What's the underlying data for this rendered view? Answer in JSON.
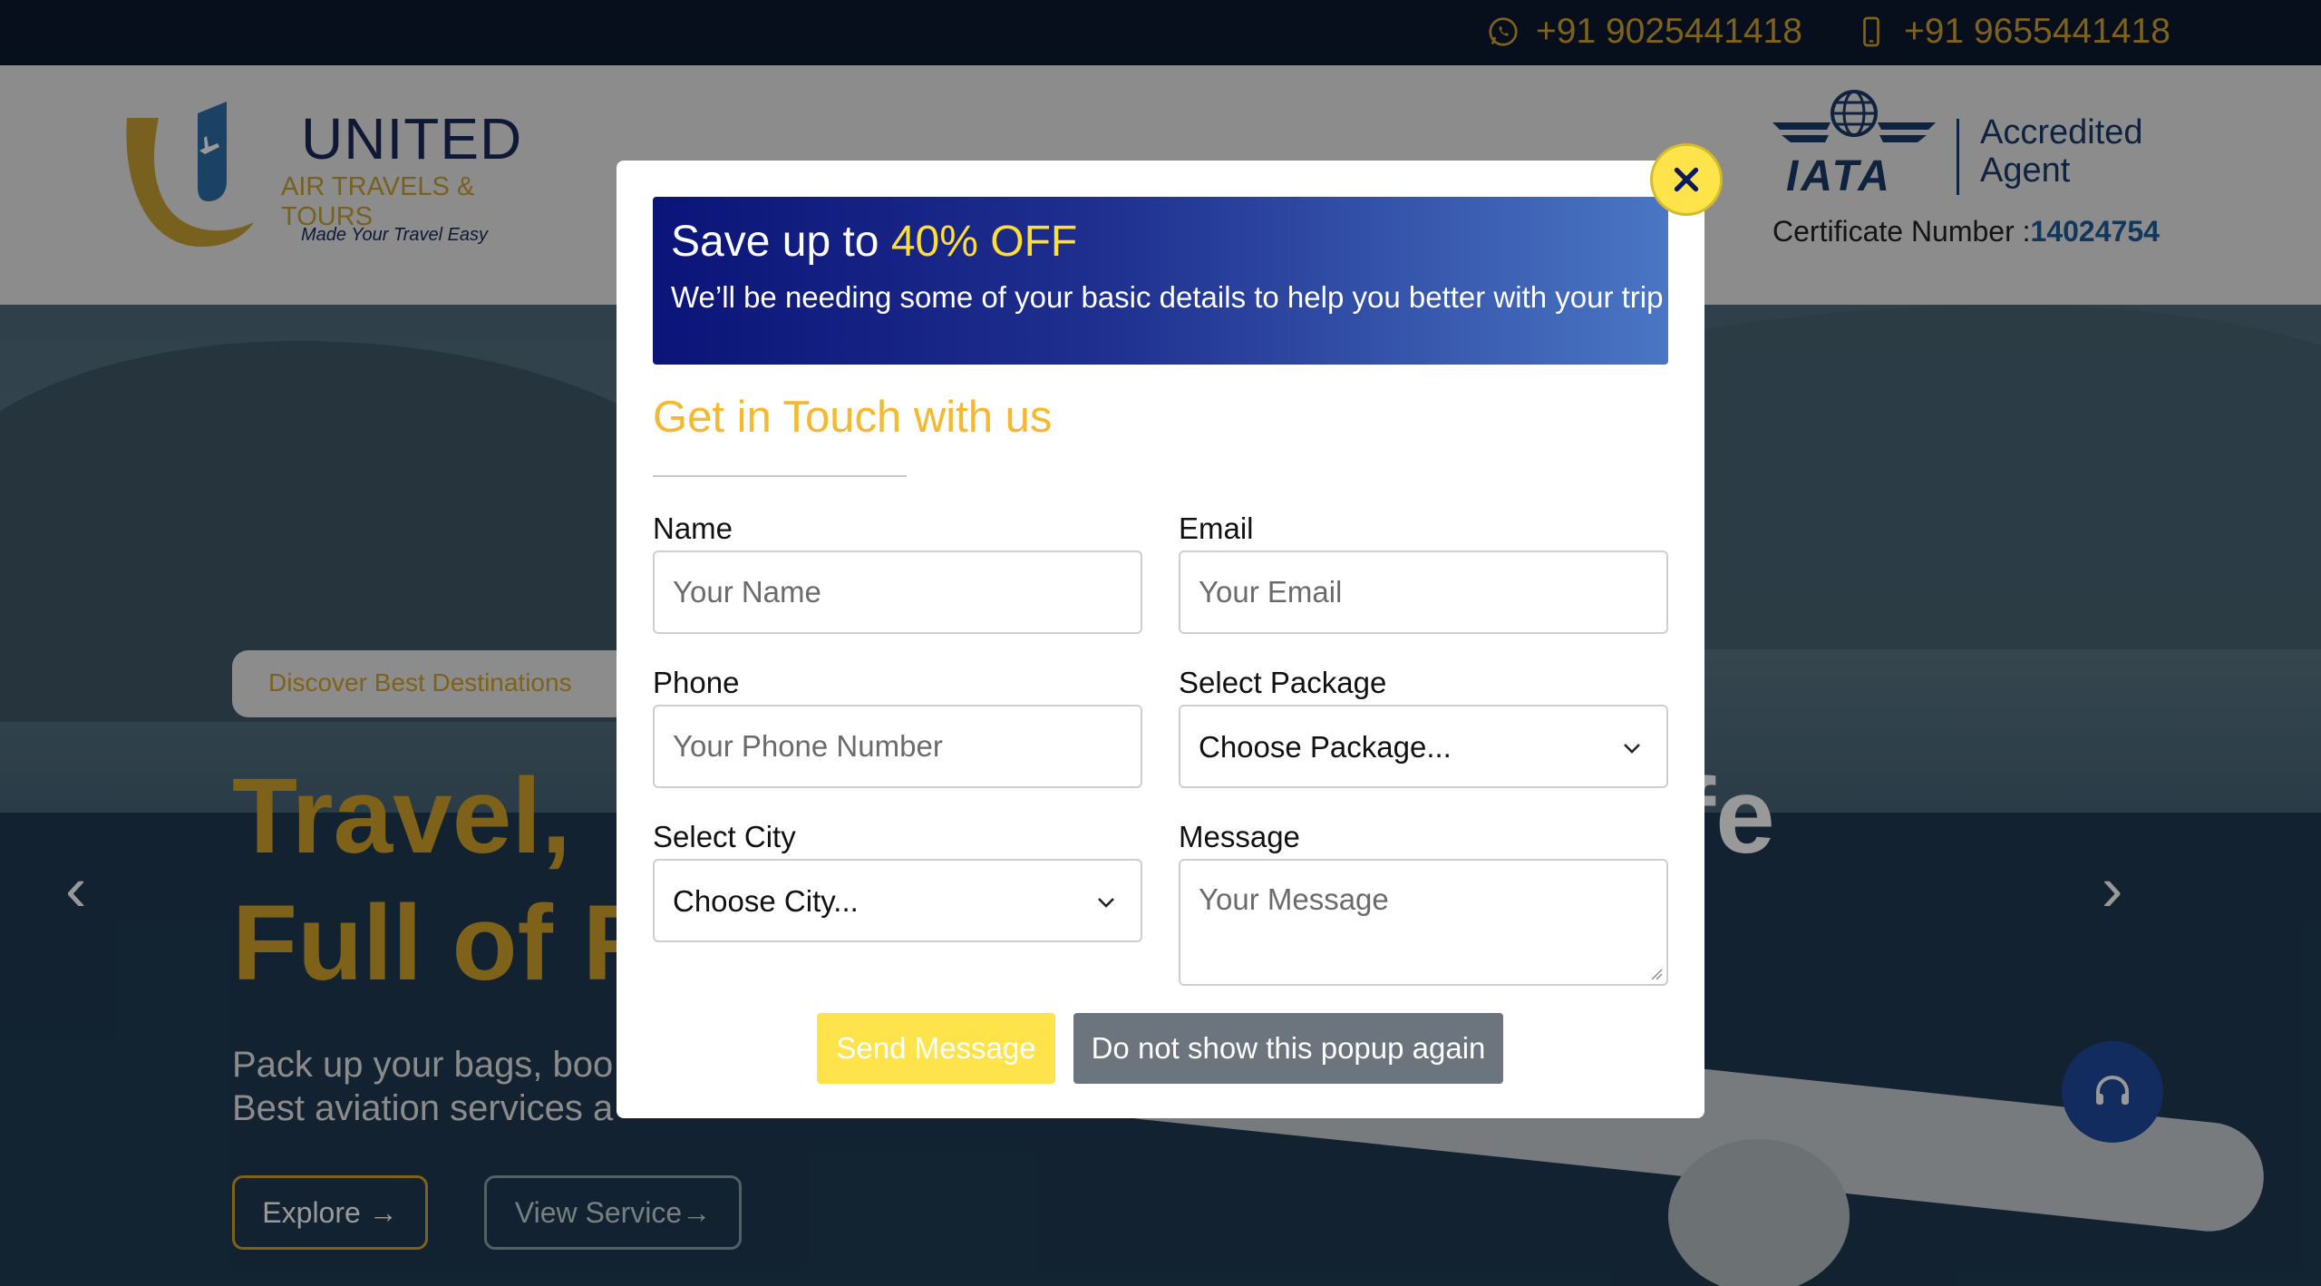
{
  "topbar": {
    "whatsapp_number": "+91 9025441418",
    "mobile_number": "+91 9655441418",
    "whatsapp_icon": "whatsapp-icon",
    "mobile_icon": "mobile-phone-icon"
  },
  "logo": {
    "title": "UNITED",
    "subtitle": "AIR TRAVELS & TOURS",
    "tagline": "Made Your Travel Easy"
  },
  "iata": {
    "word": "IATA",
    "accredited_line1": "Accredited",
    "accredited_line2": "Agent",
    "cert_label": "Certificate Number :",
    "cert_number": "14024754"
  },
  "hero": {
    "badge": "Discover Best Destinations",
    "title_line1": "Travel, ",
    "title_line2": "Full of F",
    "title_right": "ife",
    "subtitle_line1": "Pack up your bags, boo",
    "subtitle_line2": "Best aviation services a",
    "explore_label": "Explore →",
    "view_label": "View Service→"
  },
  "modal": {
    "banner_title_prefix": "Save up to ",
    "banner_title_highlight": "40% OFF",
    "banner_text": "We’ll be needing some of your basic details to help you better with your trip",
    "heading": "Get in Touch with us",
    "name_label": "Name",
    "name_placeholder": "Your Name",
    "email_label": "Email",
    "email_placeholder": "Your Email",
    "phone_label": "Phone",
    "phone_placeholder": "Your Phone Number",
    "package_label": "Select Package",
    "package_value": "Choose Package...",
    "city_label": "Select City",
    "city_value": "Choose City...",
    "message_label": "Message",
    "message_placeholder": "Your Message",
    "send_label": "Send Message",
    "dont_show_label": "Do not show this popup again"
  },
  "colors": {
    "gold": "#d4a32c",
    "navy": "#0d1930",
    "banner_start": "#0b1478",
    "banner_end": "#4a76c4",
    "send_button": "#ffe34a",
    "secondary_button": "#6c757d"
  }
}
